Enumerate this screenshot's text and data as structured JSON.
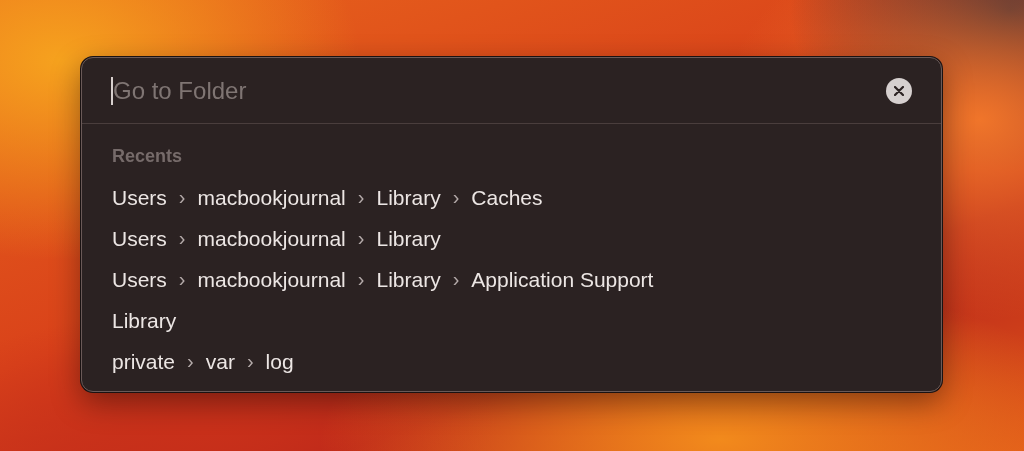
{
  "dialog": {
    "search": {
      "placeholder": "Go to Folder"
    },
    "recents": {
      "heading": "Recents",
      "paths": [
        {
          "segments": [
            {
              "kind": "folder",
              "text": "Users"
            },
            {
              "kind": "separator",
              "text": "›"
            },
            {
              "kind": "folder",
              "text": "macbookjournal"
            },
            {
              "kind": "separator",
              "text": "›"
            },
            {
              "kind": "folder",
              "text": "Library"
            },
            {
              "kind": "separator",
              "text": "›"
            },
            {
              "kind": "folder",
              "text": "Caches"
            }
          ]
        },
        {
          "segments": [
            {
              "kind": "folder",
              "text": "Users"
            },
            {
              "kind": "separator",
              "text": "›"
            },
            {
              "kind": "folder",
              "text": "macbookjournal"
            },
            {
              "kind": "separator",
              "text": "›"
            },
            {
              "kind": "folder",
              "text": "Library"
            }
          ]
        },
        {
          "segments": [
            {
              "kind": "folder",
              "text": "Users"
            },
            {
              "kind": "separator",
              "text": "›"
            },
            {
              "kind": "folder",
              "text": "macbookjournal"
            },
            {
              "kind": "separator",
              "text": "›"
            },
            {
              "kind": "folder",
              "text": "Library"
            },
            {
              "kind": "separator",
              "text": "›"
            },
            {
              "kind": "folder",
              "text": "Application Support"
            }
          ]
        },
        {
          "segments": [
            {
              "kind": "folder",
              "text": "Library"
            }
          ]
        },
        {
          "segments": [
            {
              "kind": "folder",
              "text": "private"
            },
            {
              "kind": "separator",
              "text": "›"
            },
            {
              "kind": "folder",
              "text": "var"
            },
            {
              "kind": "separator",
              "text": "›"
            },
            {
              "kind": "folder",
              "text": "log"
            }
          ]
        }
      ]
    }
  }
}
